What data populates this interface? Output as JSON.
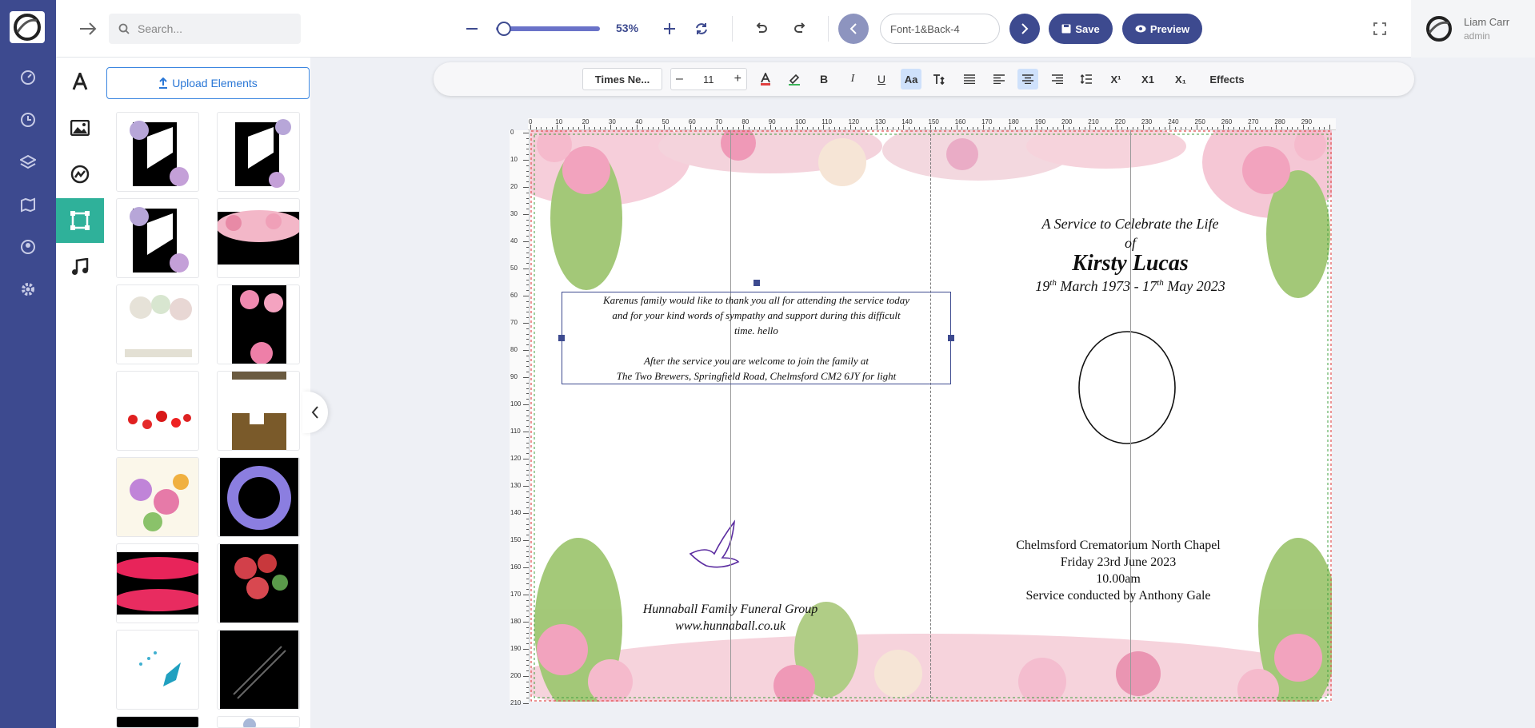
{
  "topbar": {
    "search_placeholder": "Search...",
    "zoom": "53%",
    "page_name": "Font-1&Back-4",
    "save_label": "Save",
    "preview_label": "Preview"
  },
  "user": {
    "name": "Liam Carr",
    "role": "admin"
  },
  "panel": {
    "upload_label": "Upload Elements"
  },
  "format": {
    "font": "Times Ne...",
    "size": "11",
    "sup_label": "X¹",
    "x1_label": "X1",
    "sub_label": "X₁",
    "effects_label": "Effects",
    "case_label": "Aa"
  },
  "ruler": {
    "top": [
      "0",
      "10",
      "20",
      "30",
      "40",
      "50",
      "60",
      "70",
      "80",
      "90",
      "100",
      "110",
      "120",
      "130",
      "140",
      "150",
      "160",
      "170",
      "180",
      "190",
      "200",
      "210",
      "220",
      "230",
      "240",
      "250",
      "260",
      "270",
      "280",
      "290"
    ],
    "left": [
      "0",
      "10",
      "20",
      "30",
      "40",
      "50",
      "60",
      "70",
      "80",
      "90",
      "100",
      "110",
      "120",
      "130",
      "140",
      "150",
      "160",
      "170",
      "180",
      "190",
      "200",
      "210"
    ]
  },
  "doc": {
    "thanks_1": "Karenus family would like to thank you all for attending the service today",
    "thanks_2": "and for your kind words of sympathy and support during this difficult",
    "thanks_3": "time. hello",
    "after_1": "After the service you are welcome to join the family at",
    "after_2": "The Two Brewers, Springfield Road, Chelmsford CM2 6JY for light",
    "service_title": "A Service to Celebrate the Life",
    "of": "of",
    "name": "Kirsty Lucas",
    "d1": "19",
    "d1_sup": "th",
    "d1_rest": " March 1973 - 17",
    "d2_sup": "th",
    "d2_rest": " May 2023",
    "funeral_1": "Hunnaball Family Funeral Group",
    "funeral_2": "www.hunnaball.co.uk",
    "venue": "Chelmsford Crematorium North Chapel",
    "date": "Friday 23rd June 2023",
    "time": "10.00am",
    "conductor": "Service conducted by Anthony Gale"
  },
  "colors": {
    "nav": "#3d4a8f",
    "accent": "#2fb19a",
    "upload": "#2a77d6"
  }
}
